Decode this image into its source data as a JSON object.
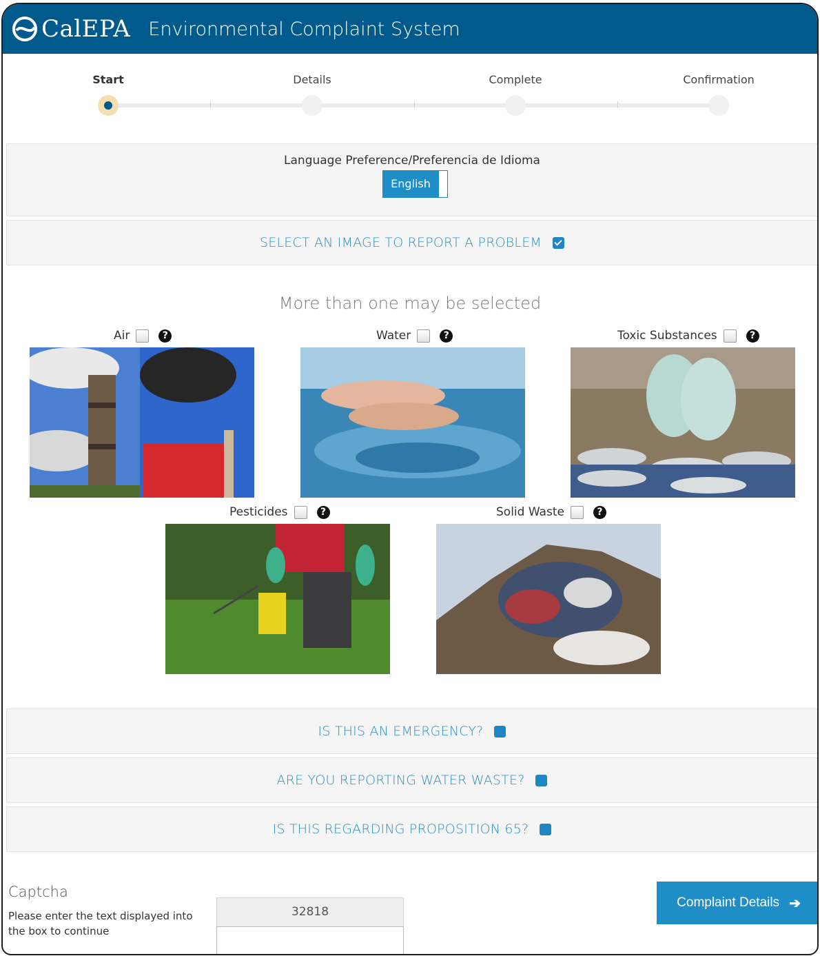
{
  "header": {
    "logo_text": "CalEPA",
    "app_title": "Environmental Complaint System"
  },
  "steps": [
    {
      "label": "Start",
      "active": true
    },
    {
      "label": "Details",
      "active": false
    },
    {
      "label": "Complete",
      "active": false
    },
    {
      "label": "Confirmation",
      "active": false
    }
  ],
  "language": {
    "title": "Language Preference/Preferencia de Idioma",
    "selected": "English"
  },
  "image_section": {
    "heading": "SELECT AN IMAGE TO REPORT A PROBLEM",
    "expanded": true,
    "subheading": "More than one may be selected",
    "categories": [
      {
        "label": "Air",
        "checked": false
      },
      {
        "label": "Water",
        "checked": false
      },
      {
        "label": "Toxic Substances",
        "checked": false
      },
      {
        "label": "Pesticides",
        "checked": false
      },
      {
        "label": "Solid Waste",
        "checked": false
      }
    ]
  },
  "sections": [
    {
      "heading": "IS THIS AN EMERGENCY?"
    },
    {
      "heading": "ARE YOU REPORTING WATER WASTE?"
    },
    {
      "heading": "IS THIS REGARDING PROPOSITION 65?"
    }
  ],
  "captcha": {
    "title": "Captcha",
    "instructions": "Please enter the text displayed into the box to continue",
    "code": "32818",
    "value": ""
  },
  "next_button": {
    "label": "Complaint Details"
  },
  "colors": {
    "header": "#005a8b",
    "accent": "#1f8ec6",
    "link": "#2a8fc4"
  }
}
